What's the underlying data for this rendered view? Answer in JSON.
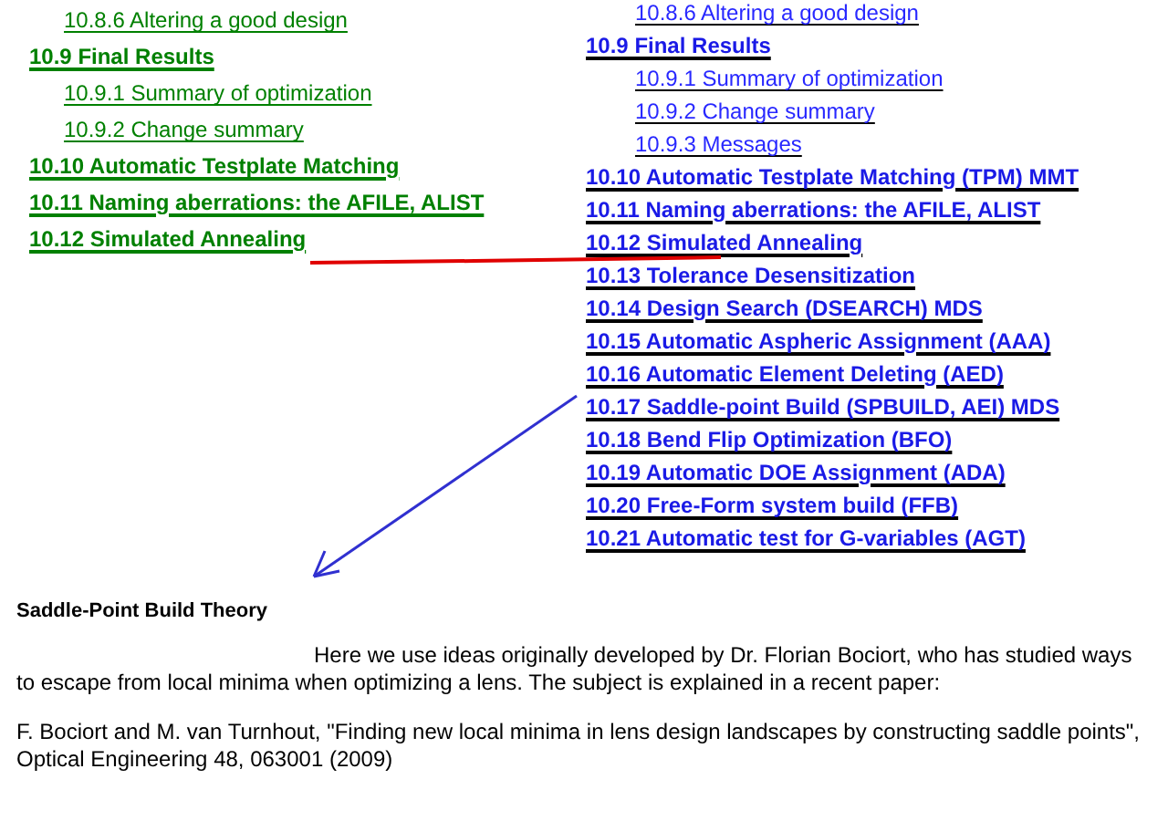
{
  "toc_left": [
    {
      "kind": "subsection",
      "text": "10.8.6 Altering a good design"
    },
    {
      "kind": "section",
      "text": "10.9 Final Results"
    },
    {
      "kind": "subsection",
      "text": "10.9.1 Summary of optimization"
    },
    {
      "kind": "subsection",
      "text": "10.9.2 Change summary"
    },
    {
      "kind": "section",
      "text": "10.10 Automatic Testplate Matching"
    },
    {
      "kind": "section",
      "text": "10.11 Naming aberrations: the AFILE, ALIST"
    },
    {
      "kind": "section",
      "text": "10.12 Simulated Annealing"
    }
  ],
  "toc_right": [
    {
      "kind": "subsection",
      "text": "10.8.6 Altering a good design"
    },
    {
      "kind": "section",
      "text": "10.9 Final Results"
    },
    {
      "kind": "subsection",
      "text": "10.9.1 Summary of optimization"
    },
    {
      "kind": "subsection",
      "text": "10.9.2 Change summary"
    },
    {
      "kind": "subsection",
      "text": "10.9.3 Messages"
    },
    {
      "kind": "section",
      "text": "10.10 Automatic Testplate Matching (TPM) MMT"
    },
    {
      "kind": "section",
      "text": "10.11 Naming aberrations: the AFILE, ALIST"
    },
    {
      "kind": "section",
      "text": "10.12 Simulated Annealing"
    },
    {
      "kind": "section",
      "text": "10.13 Tolerance Desensitization"
    },
    {
      "kind": "section",
      "text": "10.14 Design Search (DSEARCH) MDS"
    },
    {
      "kind": "section",
      "text": "10.15 Automatic Aspheric Assignment (AAA)"
    },
    {
      "kind": "section",
      "text": "10.16 Automatic Element Deleting (AED)"
    },
    {
      "kind": "section",
      "text": "10.17 Saddle-point Build (SPBUILD, AEI) MDS"
    },
    {
      "kind": "section",
      "text": "10.18 Bend Flip Optimization (BFO)"
    },
    {
      "kind": "section",
      "text": "10.19 Automatic DOE Assignment (ADA)"
    },
    {
      "kind": "section",
      "text": "10.20 Free-Form system build (FFB)"
    },
    {
      "kind": "section",
      "text": "10.21 Automatic test for G-variables (AGT)"
    }
  ],
  "article": {
    "heading": "Saddle-Point Build Theory",
    "paragraph": "Here we use ideas originally developed by Dr. Florian Bociort, who has studied ways to escape from local minima when optimizing a lens.  The subject is explained in a recent paper:",
    "citation": "F.  Bociort and M. van Turnhout, \"Finding new local minima in lens design landscapes by constructing saddle points\", Optical Engineering 48, 063001 (2009)"
  }
}
